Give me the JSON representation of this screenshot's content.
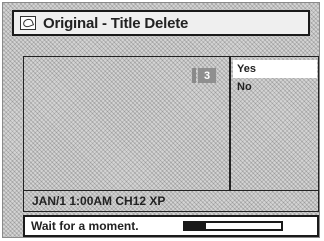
{
  "header": {
    "title": "Original - Title Delete",
    "icon": "disc-icon"
  },
  "preview": {
    "title_number": "3"
  },
  "menu": {
    "items": [
      {
        "label": "Yes",
        "selected": true
      },
      {
        "label": "No",
        "selected": false
      }
    ]
  },
  "info": {
    "text": "JAN/1 1:00AM CH12 XP"
  },
  "status": {
    "message": "Wait for a moment.",
    "progress": 0.22
  },
  "colors": {
    "background": "#d4d4d4",
    "highlight": "#ffffff",
    "frame": "#1a1a1a",
    "badge": "#8f8f8f"
  }
}
